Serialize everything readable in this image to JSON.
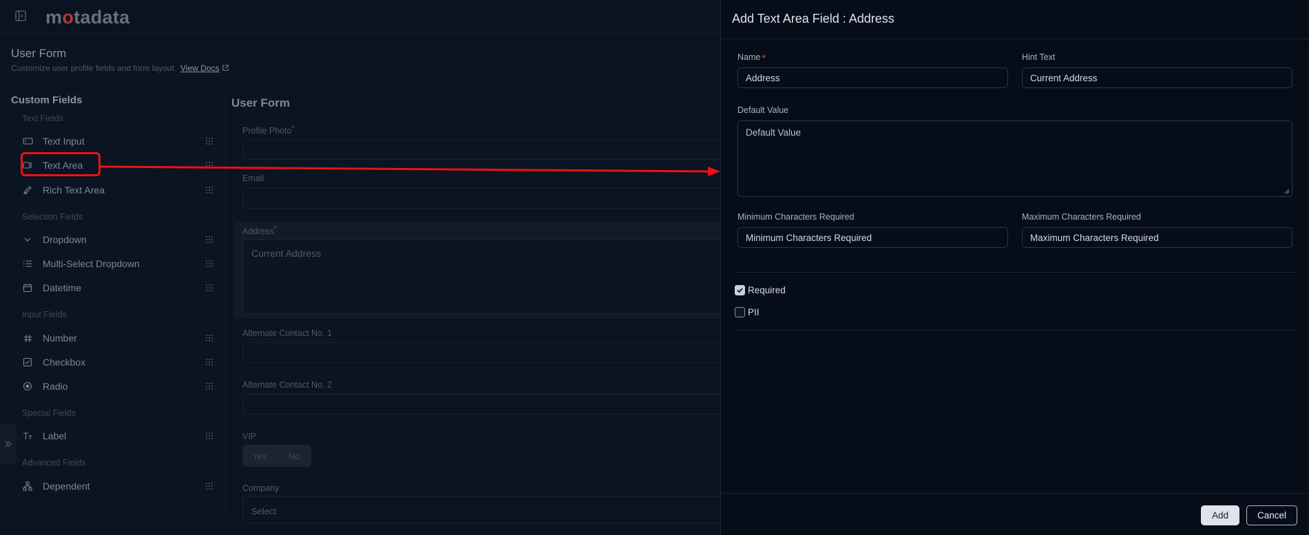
{
  "header": {
    "logo": "motadata"
  },
  "page": {
    "title": "User Form",
    "subtitle": "Customize user profile fields and form layout.",
    "docs_link": "View Docs"
  },
  "custom_fields": {
    "title": "Custom Fields",
    "sections": {
      "text": "Text Fields",
      "selection": "Selection Fields",
      "input": "Input Fields",
      "special": "Special Fields",
      "advanced": "Advanced Fields"
    },
    "items": {
      "text_input": "Text Input",
      "text_area": "Text Area",
      "rich_text_area": "Rich Text Area",
      "dropdown": "Dropdown",
      "multi_select": "Multi-Select Dropdown",
      "datetime": "Datetime",
      "number": "Number",
      "checkbox": "Checkbox",
      "radio": "Radio",
      "label": "Label",
      "dependent": "Dependent"
    }
  },
  "user_form": {
    "title": "User Form",
    "profile_photo": "Profile Photo",
    "email": "Email",
    "address": "Address",
    "address_placeholder": "Current Address",
    "alt_contact_1": "Alternate Contact No. 1",
    "alt_contact_2": "Alternate Contact No. 2",
    "vip": "VIP",
    "vip_yes": "Yes",
    "vip_no": "No",
    "company": "Company",
    "company_select": "Select",
    "required_mark": "*"
  },
  "drawer": {
    "title": "Add Text Area Field : Address",
    "name_label": "Name",
    "name_value": "Address",
    "hint_label": "Hint Text",
    "hint_value": "Current Address",
    "default_label": "Default Value",
    "default_value": "Default Value",
    "min_label": "Minimum Characters Required",
    "min_placeholder": "Minimum Characters Required",
    "max_label": "Maximum Characters Required",
    "max_placeholder": "Maximum Characters Required",
    "required_label": "Required",
    "pii_label": "PII",
    "add_button": "Add",
    "cancel_button": "Cancel",
    "required_mark": "*"
  },
  "colors": {
    "annotation": "#ee1111",
    "accent": "#dfe4ec"
  }
}
